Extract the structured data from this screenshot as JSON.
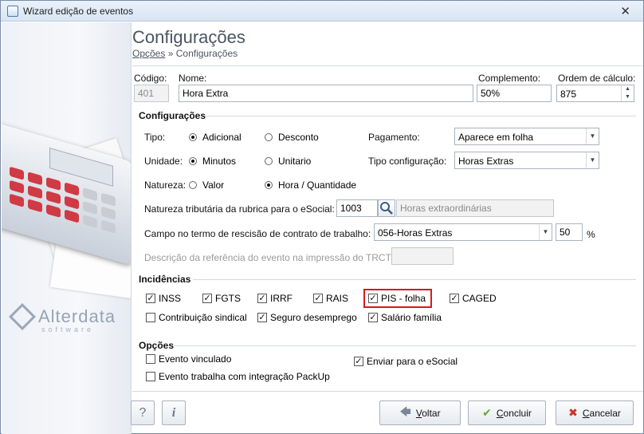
{
  "window": {
    "title": "Wizard edição de eventos",
    "close_glyph": "✕"
  },
  "brand": {
    "name": "Alterdata",
    "sub": "software"
  },
  "header": {
    "title": "Configurações",
    "breadcrumb_link": "Opções",
    "breadcrumb_sep": "»",
    "breadcrumb_current": "Configurações"
  },
  "fields": {
    "codigo": {
      "label": "Código:",
      "value": "401"
    },
    "nome": {
      "label": "Nome:",
      "value": "Hora Extra"
    },
    "complemento": {
      "label": "Complemento:",
      "value": "50%"
    },
    "ordem": {
      "label": "Ordem de cálculo:",
      "value": "875"
    }
  },
  "configuracoes": {
    "section_label": "Configurações",
    "tipo": {
      "label": "Tipo:",
      "options": [
        "Adicional",
        "Desconto"
      ],
      "selected": "Adicional"
    },
    "unidade": {
      "label": "Unidade:",
      "options": [
        "Minutos",
        "Unitario"
      ],
      "selected": "Minutos"
    },
    "natureza": {
      "label": "Natureza:",
      "options": [
        "Valor",
        "Hora / Quantidade"
      ],
      "selected": "Hora / Quantidade"
    },
    "pagamento": {
      "label": "Pagamento:",
      "value": "Aparece em folha"
    },
    "tipo_config": {
      "label": "Tipo configuração:",
      "value": "Horas Extras"
    },
    "natureza_trib": {
      "label": "Natureza tributária da rubrica para o eSocial:",
      "code": "1003",
      "description": "Horas extraordinárias"
    },
    "campo_rescisao": {
      "label": "Campo no termo de rescisão de contrato de trabalho:",
      "value": "056-Horas Extras",
      "percent": "50",
      "percent_sign": "%"
    },
    "descricao_trct": {
      "label": "Descrição da referência do evento na impressão do TRCT:",
      "value": ""
    }
  },
  "incidencias": {
    "section_label": "Incidências",
    "items": [
      {
        "label": "INSS",
        "checked": true
      },
      {
        "label": "FGTS",
        "checked": true
      },
      {
        "label": "IRRF",
        "checked": true
      },
      {
        "label": "RAIS",
        "checked": true
      },
      {
        "label": "PIS - folha",
        "checked": true
      },
      {
        "label": "CAGED",
        "checked": true
      },
      {
        "label": "Contribuição sindical",
        "checked": false
      },
      {
        "label": "Seguro desemprego",
        "checked": true
      },
      {
        "label": "Salário família",
        "checked": true
      }
    ],
    "highlight_color": "#d9181e"
  },
  "opcoes": {
    "section_label": "Opções",
    "evento_vinculado": {
      "label": "Evento vinculado",
      "checked": false
    },
    "integracao_packup": {
      "label": "Evento trabalha com integração PackUp",
      "checked": false
    },
    "enviar_esocial": {
      "label": "Enviar para o eSocial",
      "checked": true
    }
  },
  "footer": {
    "help_glyph": "?",
    "info_glyph": "i",
    "voltar": {
      "mnemonic": "V",
      "rest": "oltar"
    },
    "concluir": {
      "mnemonic": "C",
      "rest": "oncluir"
    },
    "cancelar": {
      "mnemonic": "C",
      "rest": "ancelar"
    }
  },
  "icons": {
    "back": "back-arrow-icon",
    "ok": "checkmark-icon",
    "cancel": "x-icon",
    "search": "search-icon"
  },
  "colors": {
    "accent_red": "#d9181e",
    "ok_green": "#6ea53a",
    "cancel_red": "#c8332a"
  }
}
